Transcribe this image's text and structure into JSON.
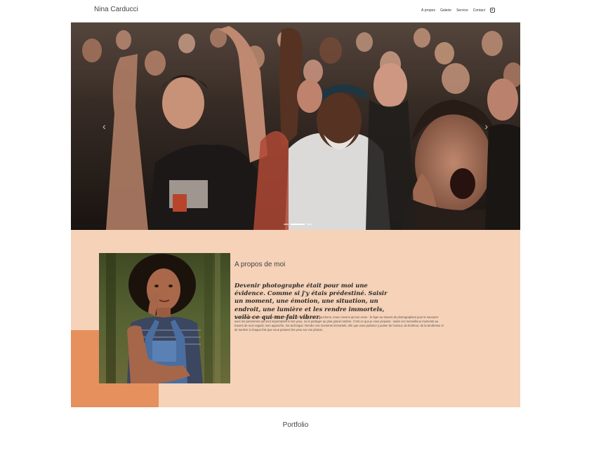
{
  "header": {
    "brand": "Nina Carducci",
    "nav": [
      {
        "label": "À propos"
      },
      {
        "label": "Galerie"
      },
      {
        "label": "Service"
      },
      {
        "label": "Contact"
      }
    ],
    "social_icon": "instagram-icon"
  },
  "hero": {
    "prev_icon": "chevron-left-icon",
    "next_icon": "chevron-right-icon",
    "prev_glyph": "‹",
    "next_glyph": "›",
    "slides_total": 3,
    "active_slide": 1
  },
  "about": {
    "title": "A propos de moi",
    "quote": "Devenir photographe était pour moi une évidence. Comme si j'y étais prédestiné. Saisir un moment, une émotion, une situation, un endroit, une lumière et les rendre immortels, voilà ce qui me fait vibrer.",
    "body": "Nous passons notre vie à chercher le bonheur, et lorsque nous y touchons, nous n'avons qu'une envie : le figer au travers de photographies pour le savourer avec les personnes qui sont importantes à nos yeux, ou le partager au plus grand nombre. C'est ce que je vous propose : saisir ces merveilleux moments au travers de mon regard, mon approche, ma technique. Rendre ces moments immortels, afin que vous puissiez y puiser de l'amour, du bonheur, de la tendresse et de lumière à chaque fois que vous poserez les yeux sur vos photos."
  },
  "sections": {
    "portfolio": "Portfolio"
  },
  "colors": {
    "about_bg": "#f5d2b8",
    "about_accent": "#e5905d",
    "text": "#333333"
  }
}
